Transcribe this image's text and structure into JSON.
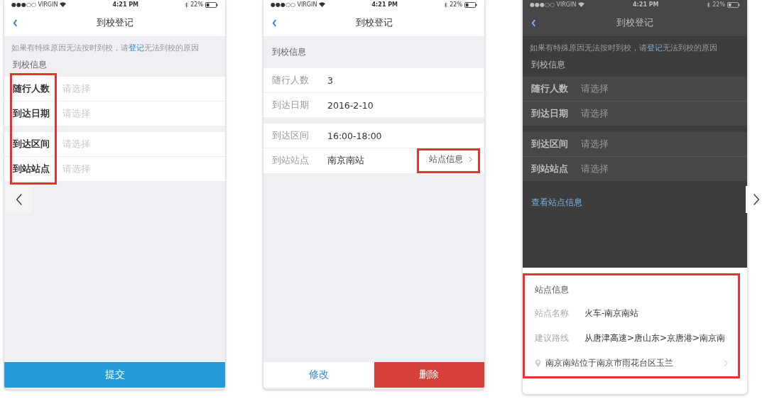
{
  "screens": [
    {
      "kind": "form",
      "status_bar": {
        "carrier": "●●●○○ VIRGIN",
        "time": "4:21 PM",
        "battery": "22%"
      },
      "title": "到校登记",
      "notice": {
        "before": "如果有特殊原因无法按时到校，请",
        "link": "登记",
        "after": "无法到校的原因"
      },
      "section": "到校信息",
      "labels_highlighted": true,
      "groups": [
        [
          {
            "label": "随行人数",
            "placeholder": "请选择"
          },
          {
            "label": "到达日期",
            "placeholder": "请选择"
          }
        ],
        [
          {
            "label": "到达区间",
            "placeholder": "请选择"
          },
          {
            "label": "到站站点",
            "placeholder": "请选择"
          }
        ]
      ],
      "buttons": [
        {
          "label": "提交",
          "kind": "primary"
        }
      ]
    },
    {
      "kind": "detail",
      "status_bar": {
        "carrier": "●●●○○ VIRGIN",
        "time": "4:21 PM",
        "battery": "22%"
      },
      "title": "到校登记",
      "section": "到校信息",
      "groups": [
        [
          {
            "label": "随行人数",
            "value": "3"
          },
          {
            "label": "到达日期",
            "value": "2016-2-10"
          }
        ],
        [
          {
            "label": "到达区间",
            "value": "16:00-18:00"
          },
          {
            "label": "到站站点",
            "value": "南京南站",
            "link": "站点信息",
            "link_highlighted": true
          }
        ]
      ],
      "buttons": [
        {
          "label": "修改",
          "kind": "plain"
        },
        {
          "label": "删除",
          "kind": "danger"
        }
      ]
    },
    {
      "kind": "form",
      "status_bar": {
        "carrier": "●●●○○ VIRGIN",
        "time": "4:21 PM",
        "battery": "22%"
      },
      "title": "到校登记",
      "notice": {
        "before": "如果有特殊原因无法按时到校，请",
        "link": "登记",
        "after": "无法到校的原因"
      },
      "section": "到校信息",
      "dimmed": true,
      "groups": [
        [
          {
            "label": "随行人数",
            "placeholder": "请选择"
          },
          {
            "label": "到达日期",
            "placeholder": "请选择"
          }
        ],
        [
          {
            "label": "到达区间",
            "placeholder": "请选择"
          },
          {
            "label": "到站站点",
            "placeholder": "请选择"
          }
        ]
      ],
      "view_link": "查看站点信息",
      "sheet": {
        "title": "站点信息",
        "highlighted": true,
        "rows": [
          {
            "label": "站点名称",
            "value": "火车-南京南站"
          },
          {
            "label": "建议路线",
            "value": "从唐津高速>唐山东>京唐港>南京南"
          }
        ],
        "address": "南京南站位于南京市雨花台区玉兰"
      }
    }
  ]
}
